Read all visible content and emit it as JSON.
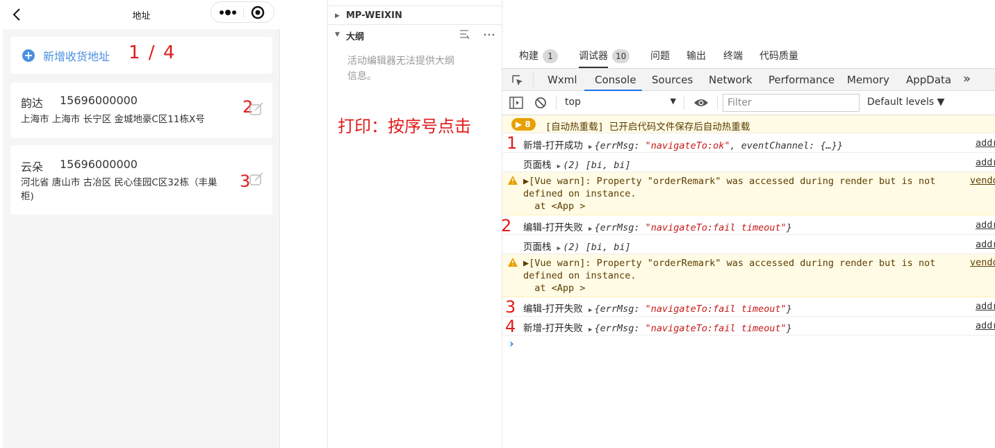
{
  "phone": {
    "title": "地址",
    "add_label": "新增收货地址",
    "add_note": "1 / 4",
    "addresses": [
      {
        "name": "韵达",
        "phone": "15696000000",
        "address": "上海市 上海市 长宁区 金城地豪C区11栋X号",
        "num": "2"
      },
      {
        "name": "云朵",
        "phone": "15696000000",
        "address_line1": "河北省 唐山市 古冶区 民心佳园C区32栋（丰巢",
        "address_line2": "柜)",
        "num": "3"
      }
    ]
  },
  "outline": {
    "rows": [
      "MP-WEIXIN",
      "大纲"
    ],
    "empty_text_1": "活动编辑器无法提供大纲",
    "empty_text_2": "信息。",
    "print_note": "打印：按序号点击"
  },
  "devtools": {
    "top_tabs": [
      {
        "label": "构建",
        "badge": "1"
      },
      {
        "label": "调试器",
        "badge": "10"
      },
      {
        "label": "问题"
      },
      {
        "label": "输出"
      },
      {
        "label": "终端"
      },
      {
        "label": "代码质量"
      }
    ],
    "panel_tabs": [
      "Wxml",
      "Console",
      "Sources",
      "Network",
      "Performance",
      "Memory",
      "AppData",
      "»"
    ],
    "context": "top",
    "filter_placeholder": "Filter",
    "levels": "Default levels ▼",
    "info": {
      "badge": "▶ 8",
      "text": "[自动热重载] 已开启代码文件保存后自动热重载"
    },
    "logs": [
      {
        "num": "1",
        "label": "新增-打开成功",
        "obj_pre": "{errMsg: ",
        "obj_str": "\"navigateTo:ok\"",
        "obj_post": ", eventChannel: {…}}",
        "src": "addr"
      },
      {
        "label": "页面栈",
        "obj_pre": "(2) [bi, bi]",
        "obj_str": "",
        "obj_post": "",
        "src": "addr"
      },
      {
        "warn_line1": "▶[Vue warn]: Property \"orderRemark\" was accessed during render but is not",
        "warn_line2": "defined on instance.",
        "warn_line3": "  at <App >",
        "src": "vendo"
      },
      {
        "num": "2",
        "label": "编辑-打开失败",
        "obj_pre": "{errMsg: ",
        "obj_str": "\"navigateTo:fail timeout\"",
        "obj_post": "}",
        "src": "addr"
      },
      {
        "label": "页面栈",
        "obj_pre": "(2) [bi, bi]",
        "obj_str": "",
        "obj_post": "",
        "src": "addr"
      },
      {
        "warn_line1": "▶[Vue warn]: Property \"orderRemark\" was accessed during render but is not",
        "warn_line2": "defined on instance.",
        "warn_line3": "  at <App >",
        "src": "vendo"
      },
      {
        "num": "3",
        "label": "编辑-打开失败",
        "obj_pre": "{errMsg: ",
        "obj_str": "\"navigateTo:fail timeout\"",
        "obj_post": "}",
        "src": "addr"
      },
      {
        "num": "4",
        "label": "新增-打开失败",
        "obj_pre": "{errMsg: ",
        "obj_str": "\"navigateTo:fail timeout\"",
        "obj_post": "}",
        "src": "addr"
      }
    ],
    "prompt": "›"
  }
}
